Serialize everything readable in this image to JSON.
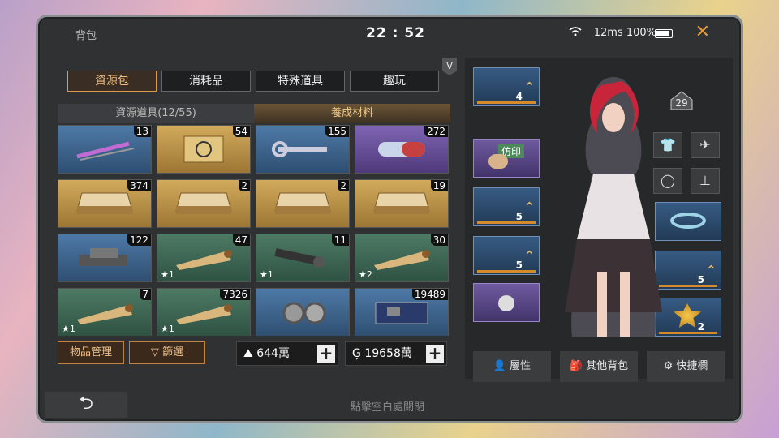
{
  "topbar": {
    "title": "背包",
    "clock": "22 : 52",
    "wifi": "",
    "status": "12ms 100%",
    "close": "✕"
  },
  "tabs": [
    {
      "label": "資源包",
      "active": true
    },
    {
      "label": "消耗品",
      "active": false
    },
    {
      "label": "特殊道具",
      "active": false
    },
    {
      "label": "趣玩",
      "active": false
    }
  ],
  "vip_badge": "V",
  "subtabs": [
    {
      "label": "資源道具(12/55)",
      "active": false
    },
    {
      "label": "養成材料",
      "active": true
    }
  ],
  "items": [
    {
      "icon": "syringe-icon",
      "bg": "blue",
      "count": "13",
      "star": ""
    },
    {
      "icon": "chip-box-icon",
      "bg": "gold",
      "count": "54",
      "star": ""
    },
    {
      "icon": "wrench-icon",
      "bg": "blue",
      "count": "155",
      "star": ""
    },
    {
      "icon": "capsule-icon",
      "bg": "purple",
      "count": "272",
      "star": ""
    },
    {
      "icon": "folder-icon",
      "bg": "gold",
      "count": "374",
      "star": ""
    },
    {
      "icon": "folder-icon",
      "bg": "gold",
      "count": "2",
      "star": ""
    },
    {
      "icon": "folder-icon",
      "bg": "gold",
      "count": "2",
      "star": ""
    },
    {
      "icon": "folder-icon",
      "bg": "gold",
      "count": "19",
      "star": ""
    },
    {
      "icon": "metal-parts-icon",
      "bg": "blue",
      "count": "122",
      "star": ""
    },
    {
      "icon": "scroll-icon",
      "bg": "green",
      "count": "47",
      "star": "★1"
    },
    {
      "icon": "gun-parts-icon",
      "bg": "green",
      "count": "11",
      "star": "★1"
    },
    {
      "icon": "scroll-icon",
      "bg": "green",
      "count": "30",
      "star": "★2"
    },
    {
      "icon": "scroll-icon",
      "bg": "green",
      "count": "7",
      "star": "★1"
    },
    {
      "icon": "scroll-icon",
      "bg": "green",
      "count": "7326",
      "star": "★1"
    },
    {
      "icon": "bearing-icon",
      "bg": "blue",
      "count": "",
      "star": ""
    },
    {
      "icon": "circuit-board-icon",
      "bg": "blue",
      "count": "19489",
      "star": ""
    }
  ],
  "buttons": {
    "manage": "物品管理",
    "filter": "篩選"
  },
  "currency": [
    {
      "icon": "mountain-icon",
      "value": "644萬"
    },
    {
      "icon": "coin-icon",
      "value": "19658萬"
    }
  ],
  "equipment": {
    "level": "29",
    "imprint_label": "仿印",
    "slots": [
      {
        "name": "helmet",
        "level": "4",
        "purple": false
      },
      {
        "name": "imprint",
        "level": "",
        "purple": true
      },
      {
        "name": "armor",
        "level": "5",
        "purple": false
      },
      {
        "name": "weapon",
        "level": "5",
        "purple": false
      },
      {
        "name": "drone",
        "level": "",
        "purple": true
      },
      {
        "name": "ring",
        "level": "",
        "purple": false
      },
      {
        "name": "blaster",
        "level": "5",
        "purple": false
      },
      {
        "name": "badge",
        "level": "2",
        "purple": false
      }
    ],
    "actions": [
      "屬性",
      "其他背包",
      "快捷欄"
    ]
  },
  "footer": {
    "hint": "點擊空白處關閉",
    "back": "⮌"
  }
}
